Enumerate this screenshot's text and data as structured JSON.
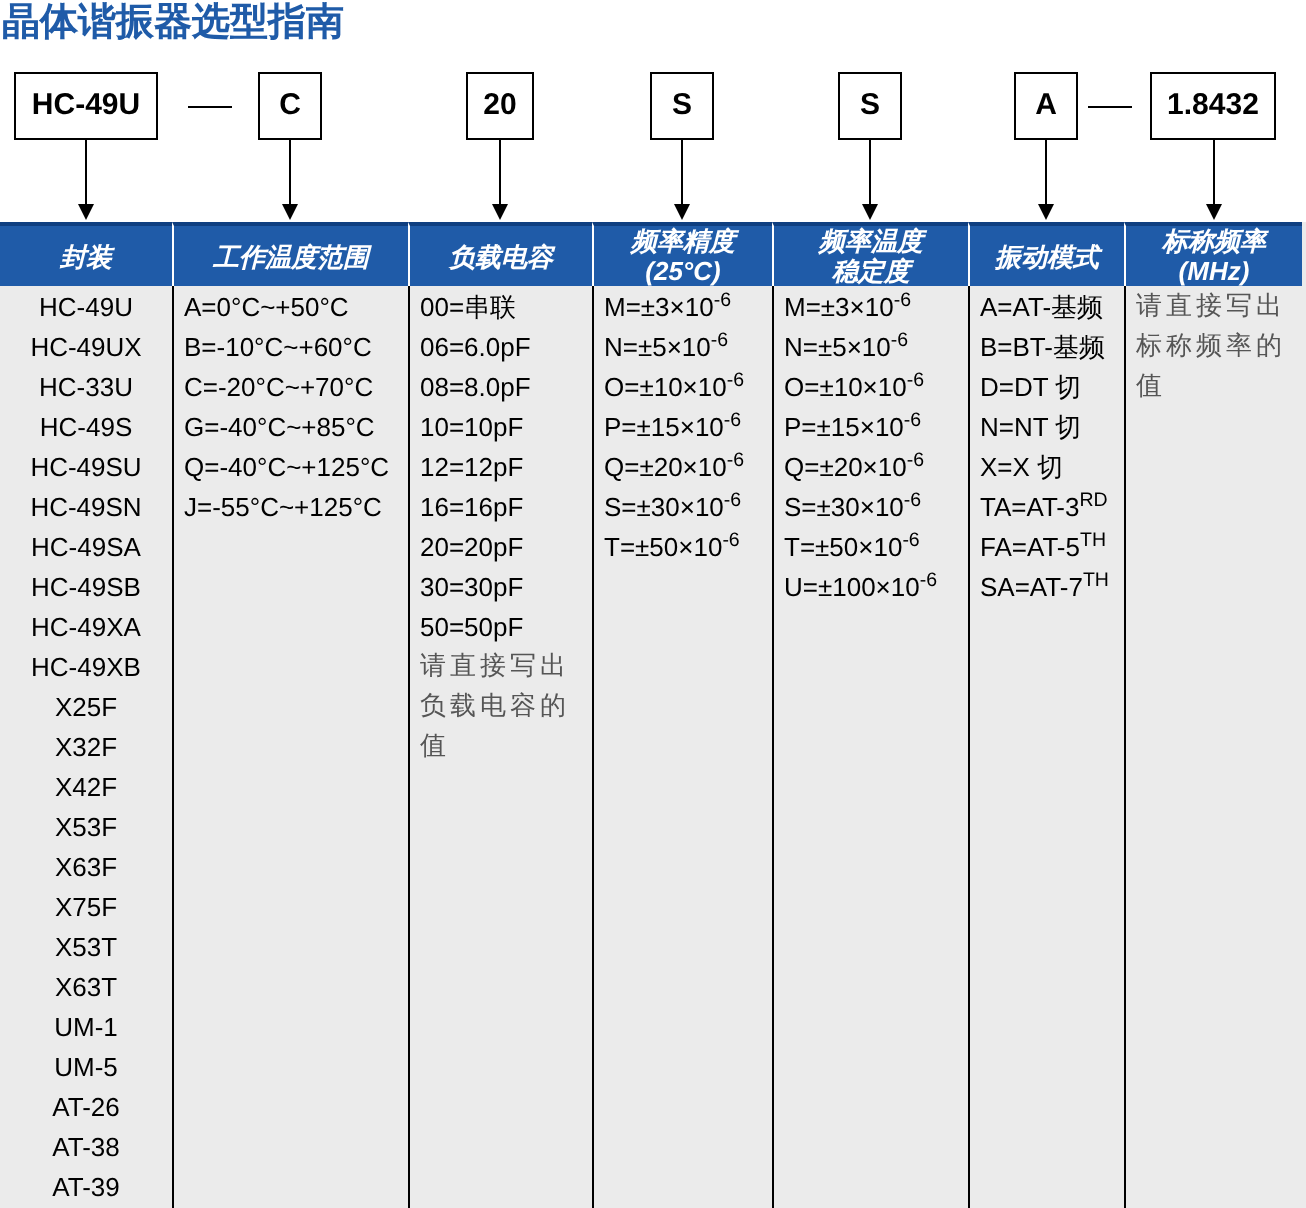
{
  "title": "晶体谐振器选型指南",
  "codes": [
    {
      "kind": "code",
      "text": "HC-49U"
    },
    {
      "kind": "dash"
    },
    {
      "kind": "code",
      "text": "C"
    },
    {
      "kind": "code",
      "text": "20"
    },
    {
      "kind": "code",
      "text": "S"
    },
    {
      "kind": "code",
      "text": "S"
    },
    {
      "kind": "code",
      "text": "A"
    },
    {
      "kind": "dash"
    },
    {
      "kind": "code",
      "text": "1.8432"
    }
  ],
  "columns": [
    {
      "header": [
        "封装"
      ],
      "items": [
        "HC-49U",
        "HC-49UX",
        "HC-33U",
        "HC-49S",
        "HC-49SU",
        "HC-49SN",
        "HC-49SA",
        "HC-49SB",
        "HC-49XA",
        "HC-49XB",
        "X25F",
        "X32F",
        "X42F",
        "X53F",
        "X63F",
        "X75F",
        "X53T",
        "X63T",
        "UM-1",
        "UM-5",
        "AT-26",
        "AT-38",
        "AT-39"
      ]
    },
    {
      "header": [
        "工作温度范围"
      ],
      "items": [
        "A=0°C~+50°C",
        "B=-10°C~+60°C",
        "C=-20°C~+70°C",
        "G=-40°C~+85°C",
        "Q=-40°C~+125°C",
        "J=-55°C~+125°C"
      ]
    },
    {
      "header": [
        "负载电容"
      ],
      "items": [
        "00=串联",
        "06=6.0pF",
        "08=8.0pF",
        "10=10pF",
        "12=12pF",
        "16=16pF",
        "20=20pF",
        "30=30pF",
        "50=50pF"
      ],
      "note": "请直接写出负载电容的值"
    },
    {
      "header": [
        "频率精度",
        "(25°C)"
      ],
      "items": [
        "M=±3×10$^{-6}$",
        "N=±5×10$^{-6}$",
        "O=±10×10$^{-6}$",
        "P=±15×10$^{-6}$",
        "Q=±20×10$^{-6}$",
        "S=±30×10$^{-6}$",
        "T=±50×10$^{-6}$"
      ]
    },
    {
      "header": [
        "频率温度",
        "稳定度"
      ],
      "items": [
        "M=±3×10$^{-6}$",
        "N=±5×10$^{-6}$",
        "O=±10×10$^{-6}$",
        "P=±15×10$^{-6}$",
        "Q=±20×10$^{-6}$",
        "S=±30×10$^{-6}$",
        "T=±50×10$^{-6}$",
        "U=±100×10$^{-6}$"
      ]
    },
    {
      "header": [
        "振动模式"
      ],
      "items": [
        "A=AT-基频",
        "B=BT-基频",
        "D=DT 切",
        "N=NT 切",
        "X=X 切",
        "TA=AT-3$^{RD}$",
        "FA=AT-5$^{TH}$",
        "SA=AT-7$^{TH}$"
      ]
    },
    {
      "header": [
        "标称频率",
        "(MHz)"
      ],
      "note": "请直接写出标称频率的值"
    }
  ]
}
